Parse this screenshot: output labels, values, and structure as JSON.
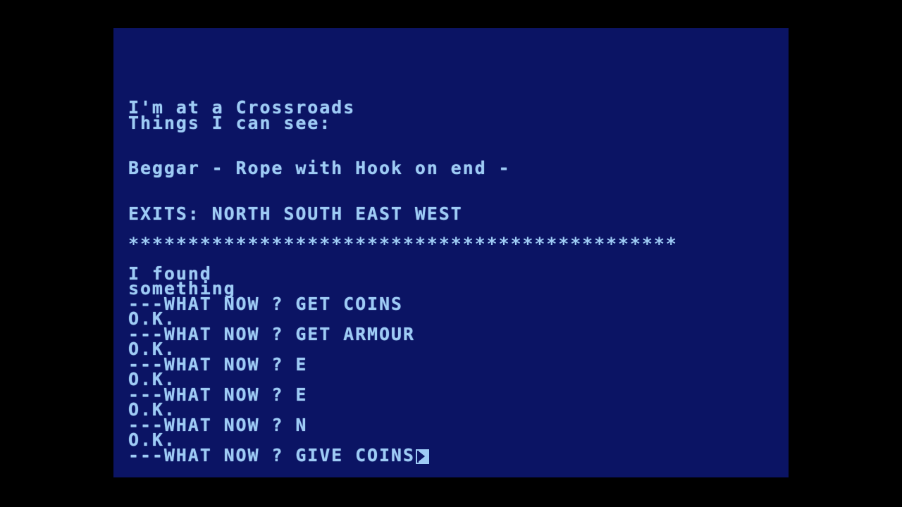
{
  "screen": {
    "background_color": "#0b1464",
    "text_color": "#9ecbf5",
    "bezel_color": "#000000"
  },
  "room": {
    "location_line": "I'm at a Crossroads",
    "things_header": "Things I can see:",
    "items_line": "Beggar - Rope with Hook on end -",
    "exits_line": "EXITS: NORTH SOUTH EAST WEST",
    "separator": "**********************************************"
  },
  "transcript": {
    "lines": [
      "I found",
      "something",
      "---WHAT NOW ? GET COINS",
      "O.K.",
      "---WHAT NOW ? GET ARMOUR",
      "O.K.",
      "---WHAT NOW ? E",
      "O.K.",
      "---WHAT NOW ? E",
      "O.K.",
      "---WHAT NOW ? N",
      "O.K.",
      "---WHAT NOW ? GIVE COINS"
    ],
    "prompt_current": "---WHAT NOW ? GIVE COINS",
    "cursor_glyph": "text-cursor"
  }
}
